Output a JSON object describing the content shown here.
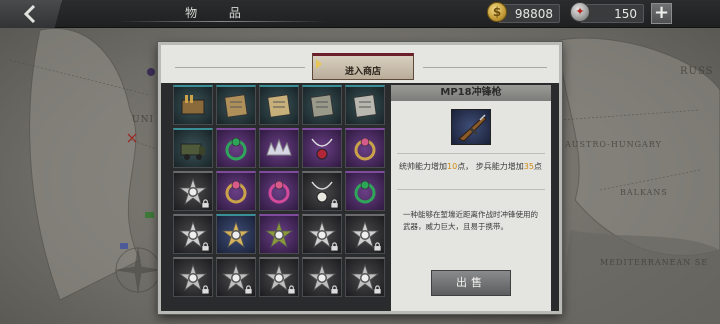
{
  "header": {
    "title": "物 品",
    "back_icon": "chevron-left-icon"
  },
  "currency": {
    "coins": "98808",
    "coin_icon": "gold-coin-icon",
    "coin_symbol": "$",
    "medals": "150",
    "medal_icon": "medal-icon",
    "add_label": "+"
  },
  "map_labels": {
    "russia": "RUSS",
    "austro_hungary": "AUSTRO-HUNGARY",
    "balkans": "BALKANS",
    "mediterranean": "MEDITERRANEAN SE",
    "uni": "UNI"
  },
  "shop": {
    "button_label": "进入商店"
  },
  "inventory": {
    "rows": [
      [
        "ammo-box",
        "map-scroll",
        "document-scroll",
        "photograph-stack",
        "letter-envelope"
      ],
      [
        "armored-truck",
        "emerald-ring",
        "crown-tiara",
        "ruby-pendant",
        "gold-ring"
      ],
      [
        "silver-medal-locked",
        "ornate-brooch",
        "gem-earrings",
        "pearl-necklace",
        "emerald-brooch"
      ],
      [
        "star-medal-locked",
        "blue-cross-medal",
        "olive-cross-medal",
        "star-medal-locked-2",
        "star-medal-locked-3"
      ],
      [
        "cross-medal-locked",
        "cross-medal-locked-2",
        "cross-medal-locked-3",
        "cross-medal-locked-4",
        "cross-medal-locked-5"
      ]
    ]
  },
  "details": {
    "item_name": "MP18冲锋枪",
    "stat_prefix": "统帅能力增加",
    "stat_value_1": "10",
    "stat_mid": "点， 步兵能力增加",
    "stat_value_2": "35",
    "stat_suffix": "点",
    "description": "一种能够在堑壕近距离作战时冲锋使用的武器，威力巨大，且易于携带。",
    "sell_label": "出售"
  },
  "colors": {
    "highlight": "#cf8a12",
    "panel_border": "#b9b9b6",
    "selected_border": "#d9c46b"
  }
}
